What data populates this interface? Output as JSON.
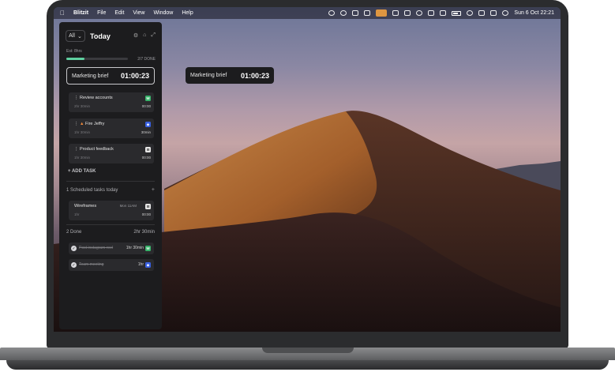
{
  "menubar": {
    "apple": "",
    "app_name": "Blitzit",
    "menus": [
      "File",
      "Edit",
      "View",
      "Window",
      "Help"
    ],
    "clock": "Sun 6 Oct  22:21"
  },
  "panel": {
    "filter": "All",
    "title": "Today",
    "estimate": "Est: 8hrs",
    "progress": 0.29,
    "progress_label": "2/7 DONE",
    "current_task": {
      "name": "Marketing brief",
      "timer": "01:00:23"
    },
    "tasks": [
      {
        "name": "Review accounts",
        "meta": "2hr 30min",
        "duration": "00:00",
        "badge": "W"
      },
      {
        "name": "Fire Jeffry",
        "meta": "1hr 30min",
        "duration": "30min",
        "badge": "◆"
      },
      {
        "name": "Product feedback",
        "meta": "1hr 30min",
        "duration": "00:00",
        "badge": "⊞"
      }
    ],
    "add_task": "+ ADD TASK",
    "scheduled_header": "1 Scheduled tasks today",
    "scheduled_plus": "+",
    "scheduled": [
      {
        "name": "Wireframes",
        "meta": "1hr",
        "when": "Mon 11AM",
        "duration": "00:00",
        "badge": "⊞"
      }
    ],
    "done_header": "2 Done",
    "done_total": "2hr 30min",
    "done": [
      {
        "name": "Post instagram reel",
        "duration": "1hr 30min",
        "badge": "W"
      },
      {
        "name": "Team meeting",
        "duration": "1hr",
        "badge": "◆"
      }
    ]
  },
  "floater": {
    "name": "Marketing brief",
    "timer": "01:00:23"
  },
  "colors": {
    "progress": "#5fd0a0",
    "panel_bg": "#1c1c1e",
    "badge_green": "#38b36a",
    "badge_blue": "#3960e0"
  }
}
